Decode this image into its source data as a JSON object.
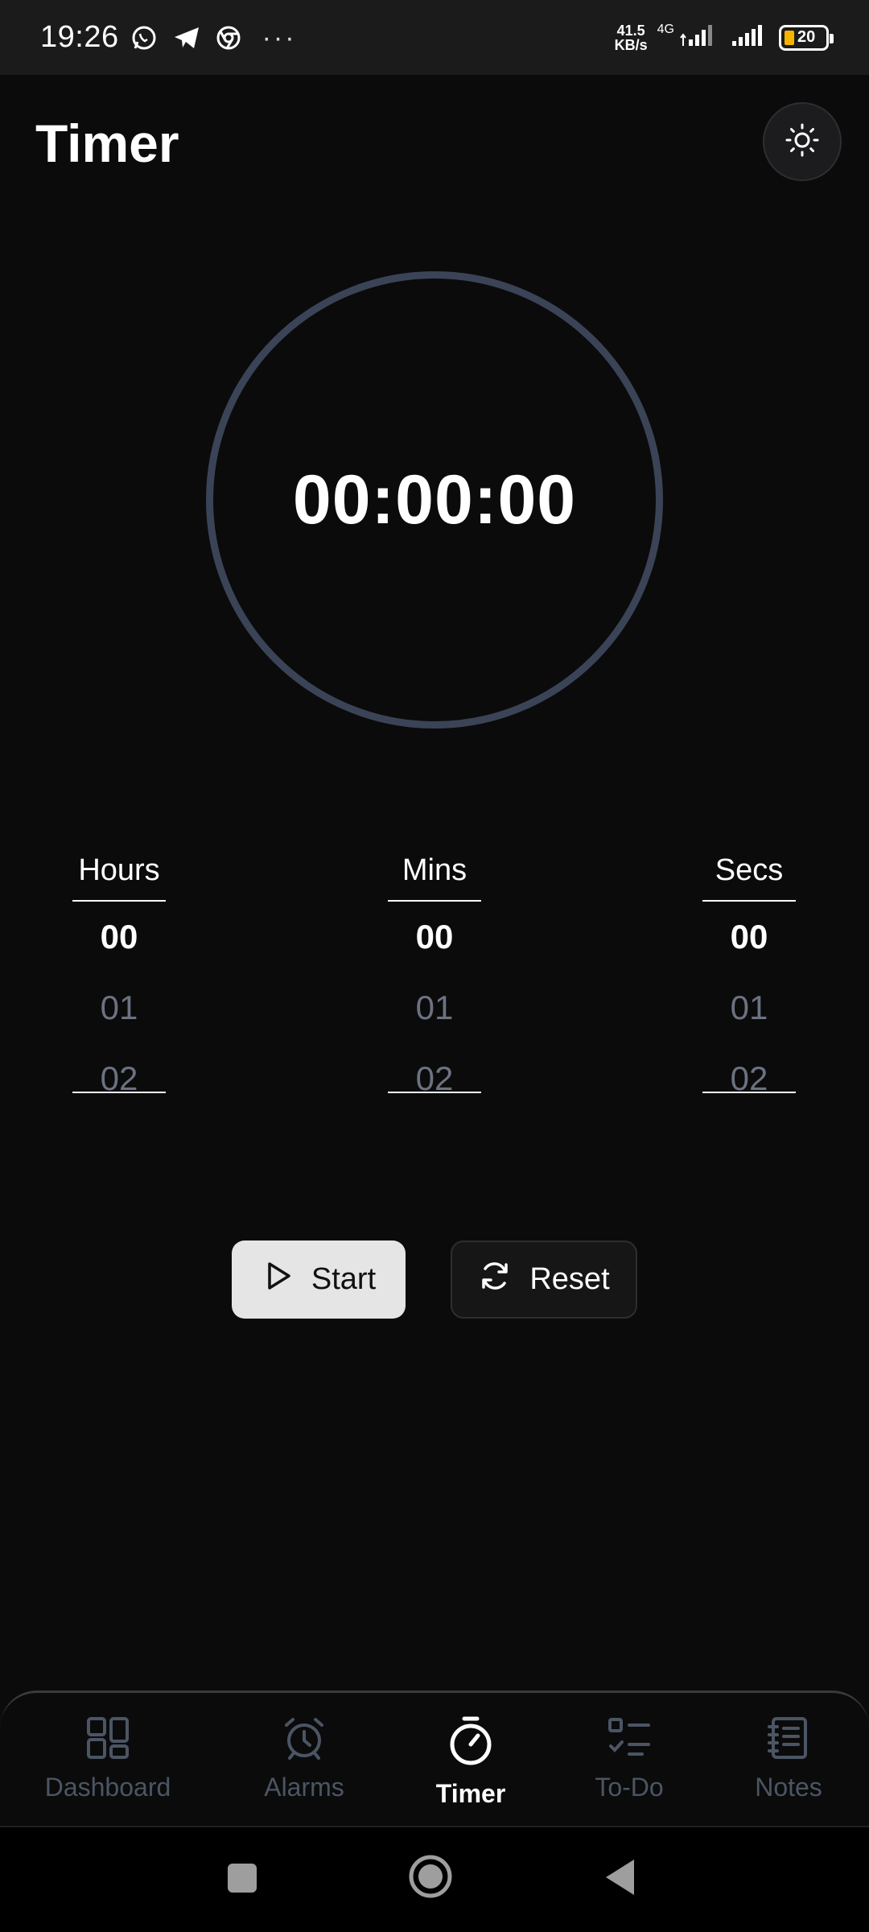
{
  "status_bar": {
    "time": "19:26",
    "more": "···",
    "speed_value": "41.5",
    "speed_unit": "KB/s",
    "network": "4G",
    "battery": "20"
  },
  "header": {
    "title": "Timer",
    "theme_icon": "sun-icon"
  },
  "dial": {
    "time_display": "00:00:00",
    "ring_color": "#3b4456"
  },
  "pickers": [
    {
      "label": "Hours",
      "options": [
        "00",
        "01",
        "02"
      ],
      "selected": "00"
    },
    {
      "label": "Mins",
      "options": [
        "00",
        "01",
        "02"
      ],
      "selected": "00"
    },
    {
      "label": "Secs",
      "options": [
        "00",
        "01",
        "02"
      ],
      "selected": "00"
    }
  ],
  "controls": {
    "start_label": "Start",
    "reset_label": "Reset"
  },
  "bottom_nav": {
    "items": [
      {
        "label": "Dashboard",
        "icon": "dashboard-icon",
        "active": false
      },
      {
        "label": "Alarms",
        "icon": "alarm-clock-icon",
        "active": false
      },
      {
        "label": "Timer",
        "icon": "stopwatch-icon",
        "active": true
      },
      {
        "label": "To-Do",
        "icon": "checklist-icon",
        "active": false
      },
      {
        "label": "Notes",
        "icon": "notebook-icon",
        "active": false
      }
    ]
  },
  "colors": {
    "background": "#0b0b0c",
    "inactive": "#4b5563",
    "muted_option": "#6b7280",
    "battery": "#f5b400"
  }
}
